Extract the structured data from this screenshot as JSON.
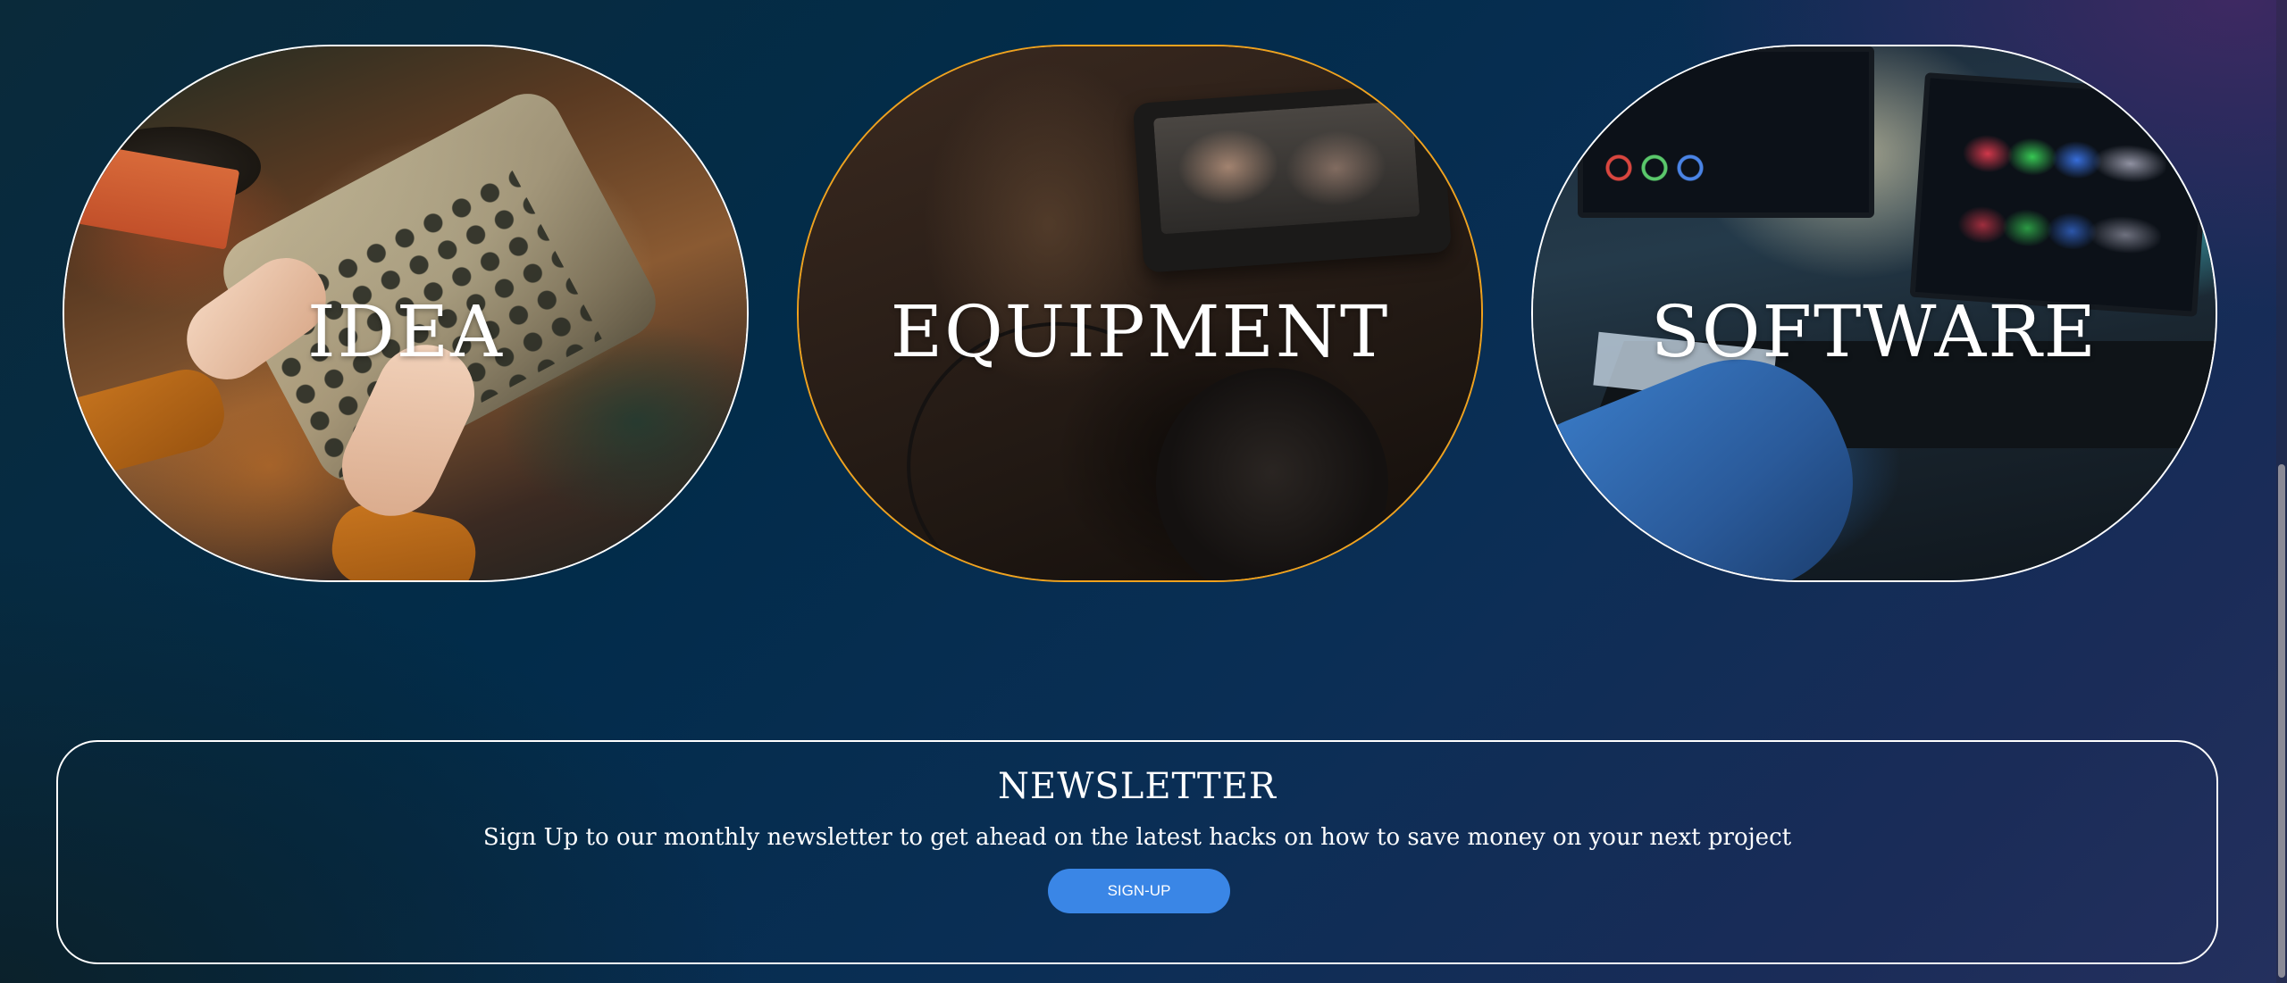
{
  "cards": [
    {
      "id": "idea",
      "title": "IDEA",
      "border_color": "#ffffff"
    },
    {
      "id": "equipment",
      "title": "EQUIPMENT",
      "border_color": "#f0a21e"
    },
    {
      "id": "software",
      "title": "SOFTWARE",
      "border_color": "#ffffff"
    }
  ],
  "newsletter": {
    "title": "NEWSLETTER",
    "text": "Sign Up to our monthly newsletter to get ahead on the latest hacks on how to save money on your next project",
    "button_label": "SIGN-UP",
    "button_color": "#3a86e6"
  }
}
